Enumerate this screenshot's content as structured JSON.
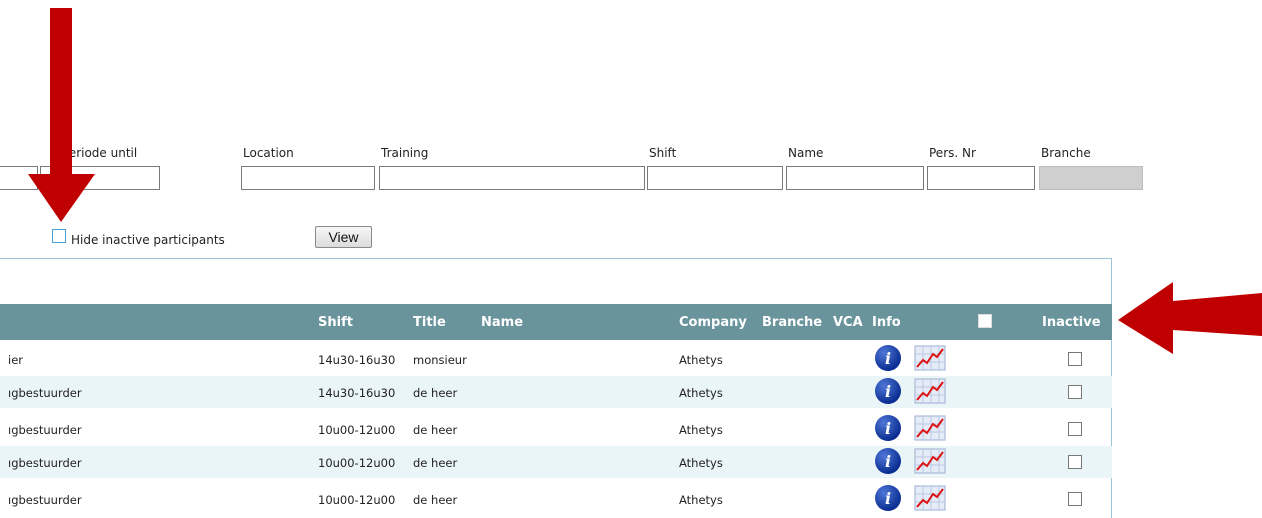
{
  "filters": {
    "periode_until": {
      "label": "Periode until",
      "value": ""
    },
    "location": {
      "label": "Location",
      "value": ""
    },
    "training": {
      "label": "Training",
      "value": ""
    },
    "shift": {
      "label": "Shift",
      "value": ""
    },
    "name": {
      "label": "Name",
      "value": ""
    },
    "pers_nr": {
      "label": "Pers. Nr",
      "value": ""
    },
    "branche": {
      "label": "Branche",
      "value": ""
    }
  },
  "hide_inactive": {
    "label": "Hide inactive participants",
    "checked": false
  },
  "view_button": "View",
  "table": {
    "headers": {
      "shift": "Shift",
      "title": "Title",
      "name": "Name",
      "company": "Company",
      "branche": "Branche",
      "vca": "VCA",
      "info": "Info",
      "inactive": "Inactive"
    },
    "rows": [
      {
        "function": "ier",
        "shift": "14u30-16u30",
        "title": "monsieur",
        "company": "Athetys"
      },
      {
        "function": "ıgbestuurder",
        "shift": "14u30-16u30",
        "title": "de heer",
        "company": "Athetys"
      },
      {
        "function": "ıgbestuurder",
        "shift": "10u00-12u00",
        "title": "de heer",
        "company": "Athetys"
      },
      {
        "function": "ıgbestuurder",
        "shift": "10u00-12u00",
        "title": "de heer",
        "company": "Athetys"
      },
      {
        "function": "ıgbestuurder",
        "shift": "10u00-12u00",
        "title": "de heer",
        "company": "Athetys"
      }
    ]
  },
  "icons": {
    "info": "info-icon",
    "chart": "chart-icon"
  },
  "colors": {
    "header_bg": "#6a949c",
    "row_alt": "#eaf5f8",
    "arrow": "#c00000",
    "info": "#0b2f92"
  }
}
